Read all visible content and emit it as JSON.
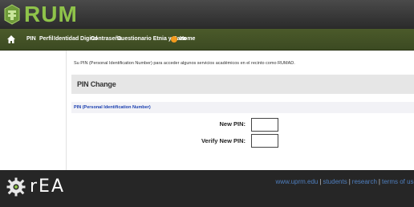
{
  "header": {
    "logo_text": "RUM"
  },
  "nav": {
    "items": [
      {
        "label": "PIN"
      },
      {
        "label": "Perfil"
      },
      {
        "label": "Identidad Digital"
      },
      {
        "label": "Contraseña"
      },
      {
        "label": "Cuestionario Etnia y Raza"
      },
      {
        "label": "Home"
      }
    ],
    "icons": [
      "home-icon",
      "orange-dot-icon"
    ],
    "colors": {
      "nav_bg": "#4b5a2a",
      "header_bg": "#2a2a2a",
      "accent": "#f39a1d",
      "logo": "#8fc34a"
    }
  },
  "main": {
    "info_text": "Su PIN (Personal Identification Number) para acceder algunos servicios académicos en el recinto como RUMAD.",
    "section_title": "PIN Change",
    "form_header": "PIN (Personal Identification Number)",
    "fields": [
      {
        "label": "New PIN:",
        "value": ""
      },
      {
        "label": "Verify New PIN:",
        "value": ""
      }
    ]
  },
  "footer": {
    "logo_text": "rEA",
    "links": [
      {
        "label": "www.uprm.edu"
      },
      {
        "label": "students"
      },
      {
        "label": "research"
      },
      {
        "label": "terms of use"
      }
    ],
    "separator": "|",
    "colors": {
      "link": "#4f7fbf",
      "bg": "#262626"
    }
  }
}
